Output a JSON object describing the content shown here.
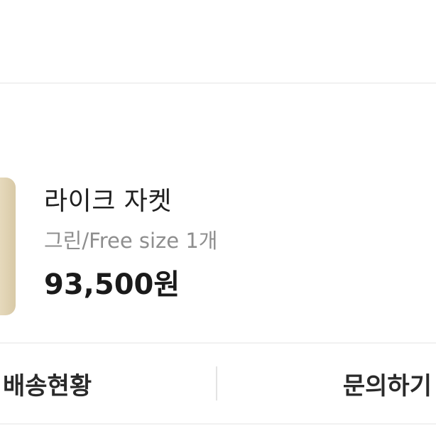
{
  "order_item": {
    "product_name": "라이크 자켓",
    "option": "그린/Free size 1개",
    "price": "93,500원"
  },
  "actions": {
    "shipping_status": "배송현황",
    "inquiry": "문의하기"
  },
  "colors": {
    "text_primary": "#1f1f1f",
    "text_secondary": "#8e8e8e",
    "divider": "#f1f1f1",
    "thumbnail": "#e8dcc0"
  }
}
